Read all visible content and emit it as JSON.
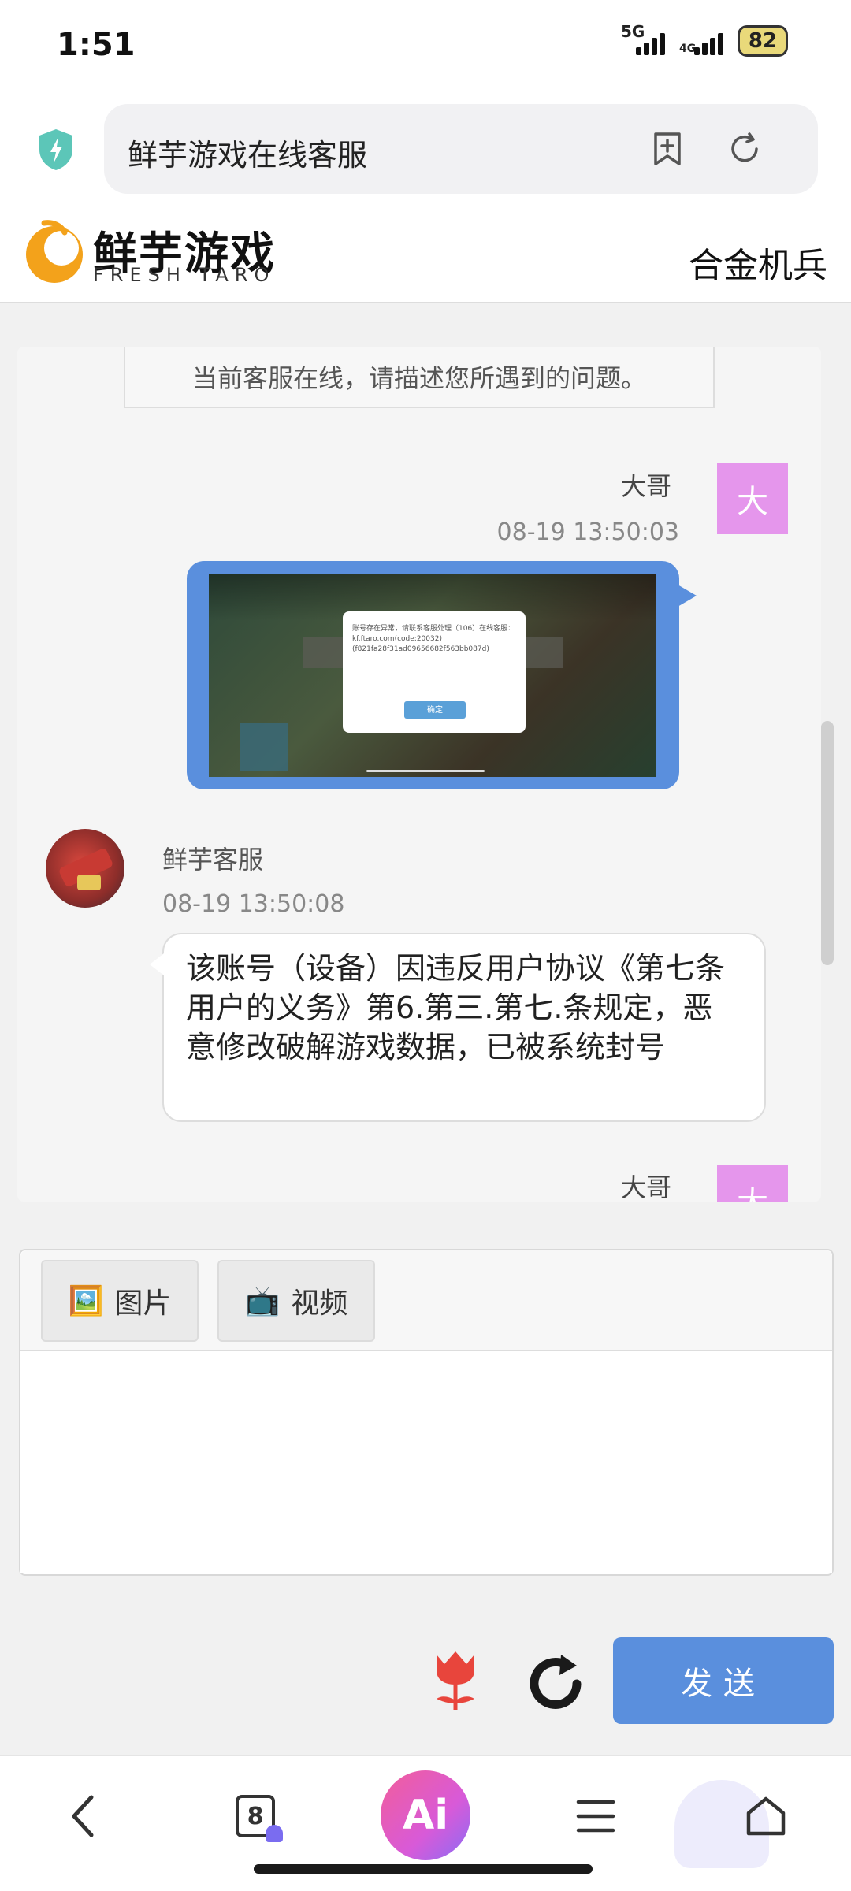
{
  "status_bar": {
    "time": "1:51",
    "network": "5G",
    "signal2": "4G",
    "battery": "82"
  },
  "browser": {
    "url_title": "鲜芋游戏在线客服"
  },
  "site": {
    "logo_name": "鲜芋游戏",
    "logo_sub": "FRESH TARO",
    "game_name": "合金机兵"
  },
  "chat": {
    "notice": "当前客服在线，请描述您所遇到的问题。",
    "messages": [
      {
        "sender": "大哥",
        "avatar_char": "大",
        "time": "08-19 13:50:03",
        "type": "image",
        "image_text": "账号存在异常，请联系客服处理（106）在线客服：kf.ftaro.com(code:20032)(f821fa28f31ad09656682f563bb087d)",
        "image_button": "确定"
      },
      {
        "sender": "鲜芋客服",
        "time": "08-19 13:50:08",
        "type": "text",
        "text": "该账号（设备）因违反用户协议《第七条用户的义务》第6.第三.第七.条规定，恶意修改破解游戏数据，已被系统封号"
      },
      {
        "sender": "大哥",
        "avatar_char": "大",
        "type": "partial"
      }
    ]
  },
  "composer": {
    "image_btn": {
      "icon": "🖼️",
      "label": "图片"
    },
    "video_btn": {
      "icon": "📺",
      "label": "视频"
    },
    "send_label": "发送"
  },
  "bottom_nav": {
    "tabs_count": "8",
    "ai_label": "Ai"
  },
  "colors": {
    "accent": "#5a8fdd",
    "user_avatar": "#e596ec"
  }
}
